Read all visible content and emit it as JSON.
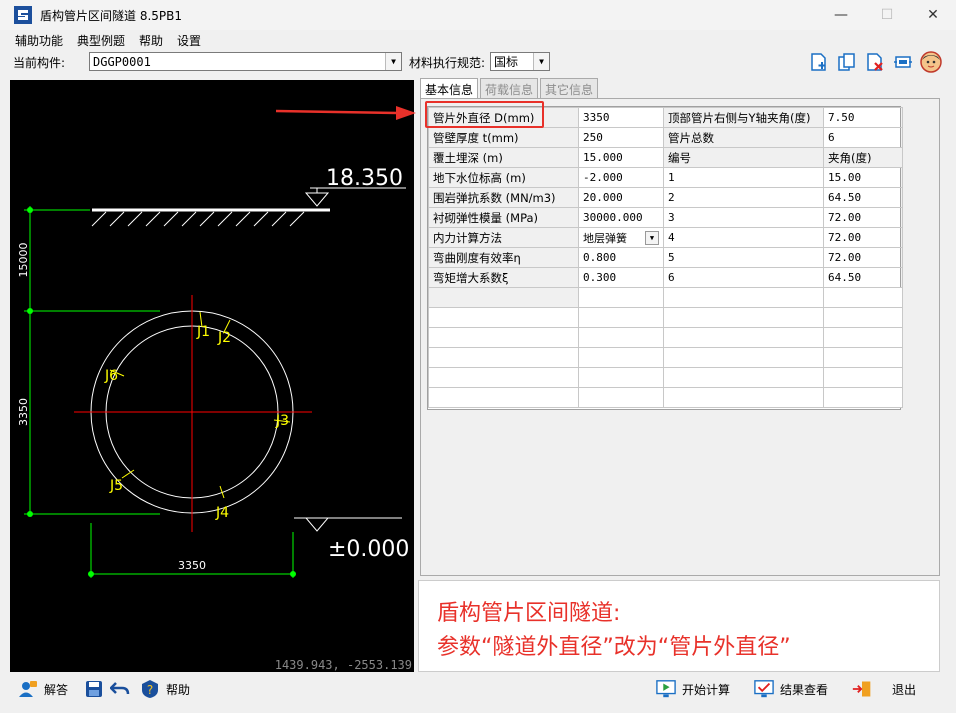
{
  "window": {
    "title": "盾构管片区间隧道 8.5PB1",
    "minimize_icon": "minimize-icon",
    "maximize_icon": "maximize-icon",
    "close_icon": "close-icon"
  },
  "menu": {
    "items": [
      "辅助功能",
      "典型例题",
      "帮助",
      "设置"
    ]
  },
  "toolbar": {
    "current_component_label": "当前构件:",
    "current_component_value": "DGGP0001",
    "material_standard_label": "材料执行规范:",
    "material_standard_value": "国标",
    "icons": [
      "add-document-icon",
      "copy-document-icon",
      "delete-document-icon",
      "export-icon",
      "user-avatar-icon"
    ]
  },
  "cad": {
    "elevation_top": "18.350",
    "elevation_bottom": "±0.000",
    "dim_vertical_top": "15000",
    "dim_vertical_bottom": "3350",
    "dim_horizontal": "3350",
    "joints": [
      "J1",
      "J2",
      "J3",
      "J4",
      "J5",
      "J6"
    ],
    "coordinates": "1439.943, -2553.139",
    "colors": {
      "background": "#000000",
      "lines": "#ffffff",
      "dimension": "#00ff00",
      "joints": "#ffff00",
      "axis": "#ff0000"
    }
  },
  "tabs": [
    "基本信息",
    "荷载信息",
    "其它信息"
  ],
  "params": {
    "left": [
      {
        "label": "管片外直径 D(mm)",
        "value": "3350"
      },
      {
        "label": "管壁厚度 t(mm)",
        "value": "250"
      },
      {
        "label": "覆土埋深 (m)",
        "value": "15.000"
      },
      {
        "label": "地下水位标高 (m)",
        "value": "-2.000"
      },
      {
        "label": "围岩弹抗系数 (MN/m3)",
        "value": "20.000"
      },
      {
        "label": "衬砌弹性模量 (MPa)",
        "value": "30000.000"
      },
      {
        "label": "内力计算方法",
        "value": "地层弹簧"
      },
      {
        "label": "弯曲刚度有效率η",
        "value": "0.800"
      },
      {
        "label": "弯矩增大系数ξ",
        "value": "0.300"
      }
    ],
    "right": [
      {
        "label": "顶部管片右侧与Y轴夹角(度)",
        "value": "7.50"
      },
      {
        "label": "管片总数",
        "value": "6"
      },
      {
        "label": "编号",
        "value": "夹角(度)"
      },
      {
        "label": "1",
        "value": "15.00"
      },
      {
        "label": "2",
        "value": "64.50"
      },
      {
        "label": "3",
        "value": "72.00"
      },
      {
        "label": "4",
        "value": "72.00"
      },
      {
        "label": "5",
        "value": "72.00"
      },
      {
        "label": "6",
        "value": "64.50"
      }
    ]
  },
  "annotation": {
    "line1": "盾构管片区间隧道:",
    "line2": "参数“隧道外直径”改为“管片外直径”",
    "color": "#e8312a"
  },
  "status_bar": {
    "answer": "解答",
    "help": "帮助",
    "start_calc": "开始计算",
    "view_results": "结果查看",
    "exit": "退出"
  }
}
